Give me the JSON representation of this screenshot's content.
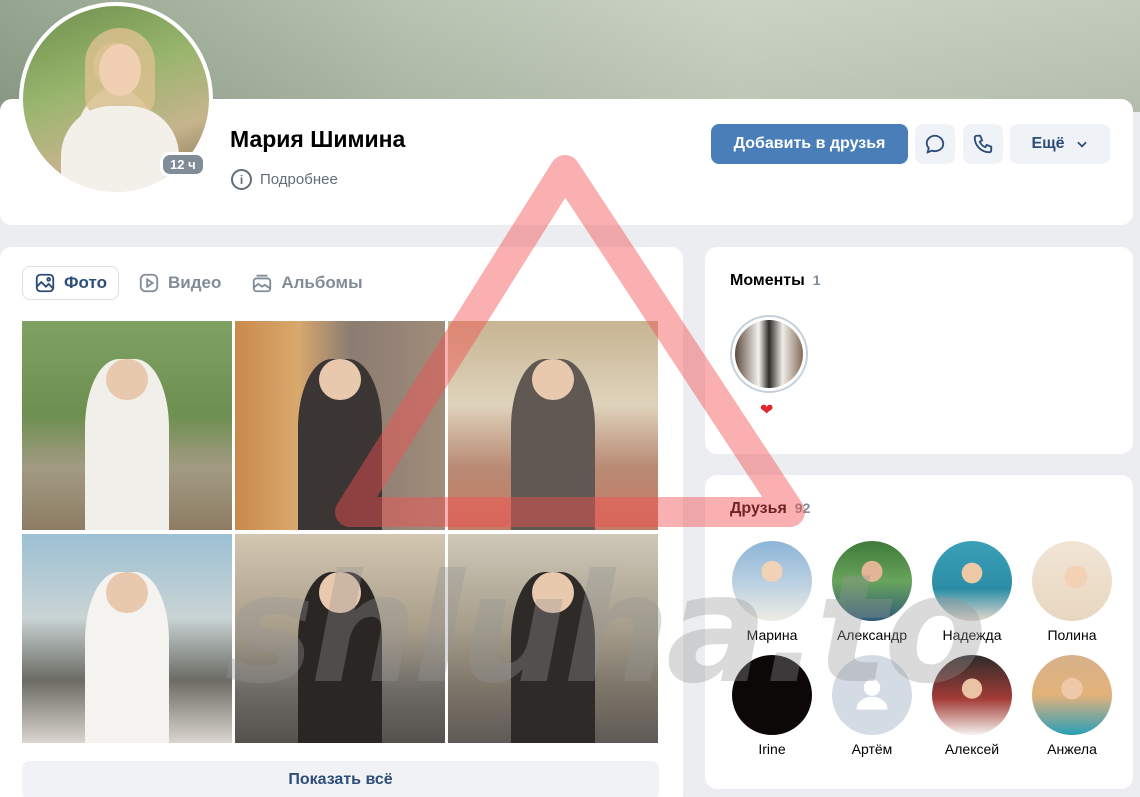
{
  "profile": {
    "name": "Мария Шимина",
    "online_badge": "12 ч",
    "details_link": "Подробнее"
  },
  "actions": {
    "add_friend": "Добавить в друзья",
    "more": "Ещё"
  },
  "media": {
    "tabs": [
      {
        "label": "Фото",
        "icon": "photo-icon",
        "active": true
      },
      {
        "label": "Видео",
        "icon": "video-icon",
        "active": false
      },
      {
        "label": "Альбомы",
        "icon": "albums-icon",
        "active": false
      }
    ],
    "show_all": "Показать всё"
  },
  "moments": {
    "title": "Моменты",
    "count": "1"
  },
  "friends": {
    "title": "Друзья",
    "count": "92",
    "items": [
      {
        "name": "Марина"
      },
      {
        "name": "Александр"
      },
      {
        "name": "Надежда"
      },
      {
        "name": "Полина"
      },
      {
        "name": "Irine"
      },
      {
        "name": "Артём"
      },
      {
        "name": "Алексей"
      },
      {
        "name": "Анжела"
      }
    ]
  },
  "watermark": "shluha.to",
  "colors": {
    "primary_button": "#4a7eb8",
    "link": "#2c4d79",
    "secondary_text": "#818c99",
    "heart": "#e0242b"
  }
}
